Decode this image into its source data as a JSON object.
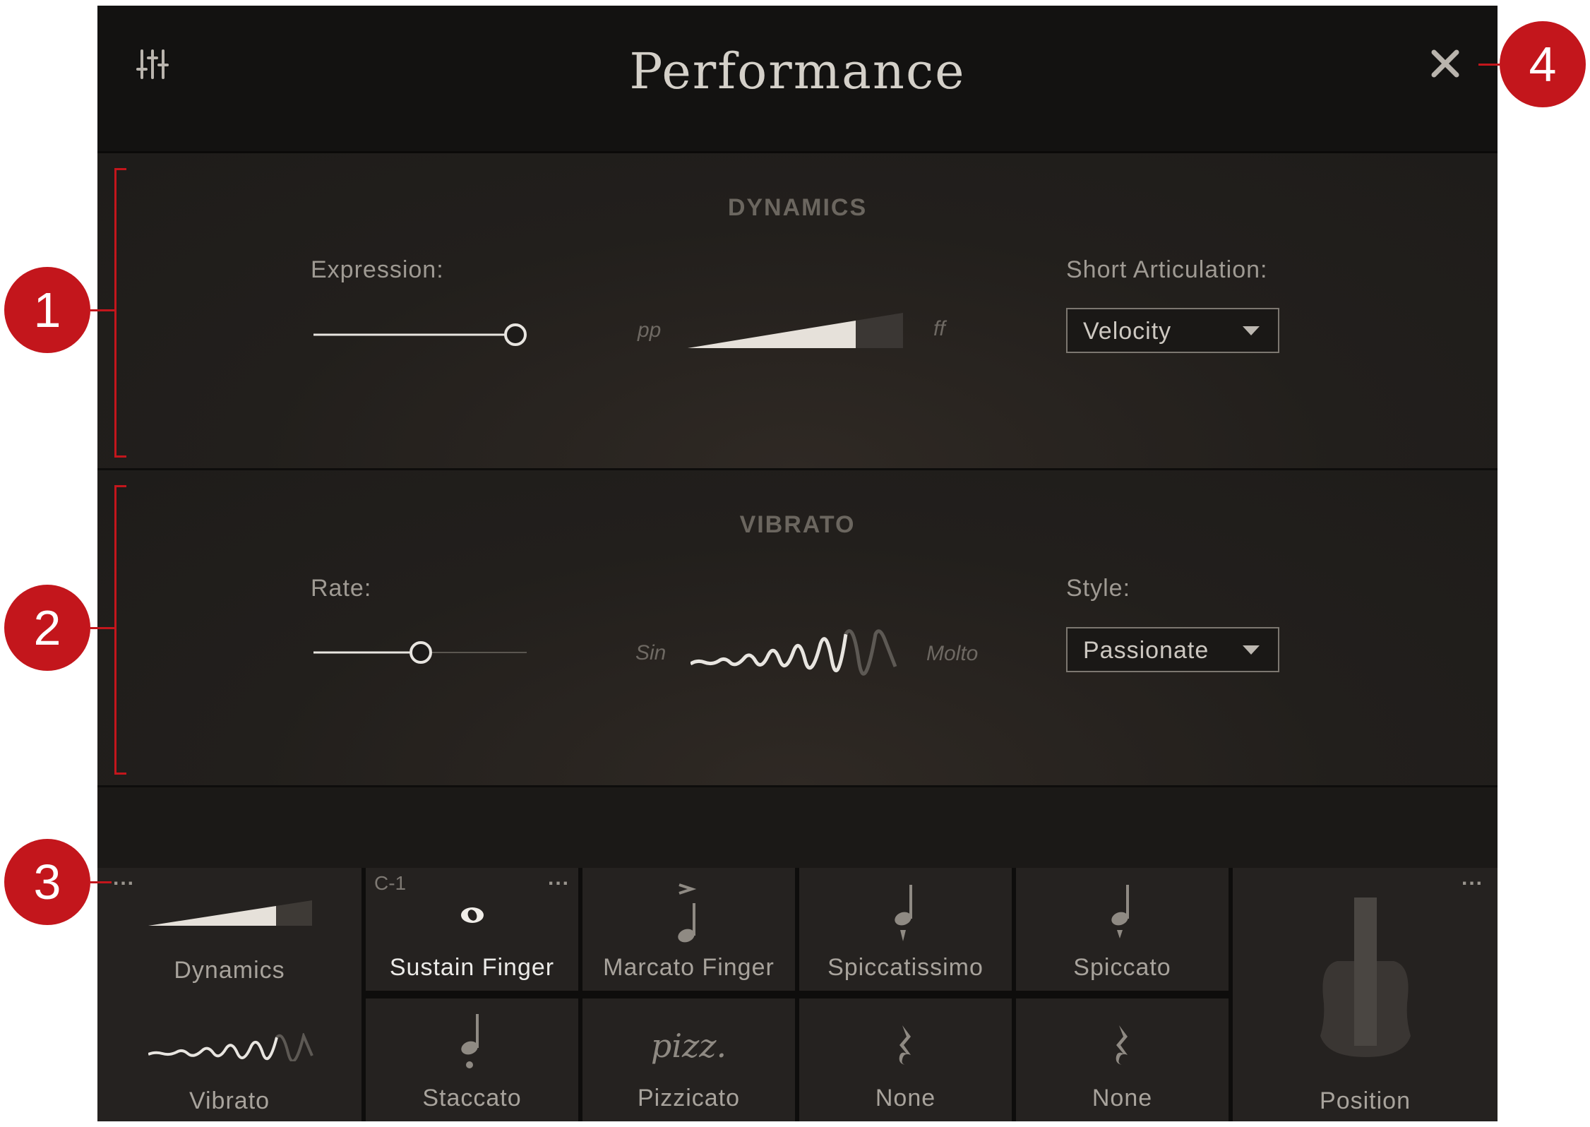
{
  "window": {
    "title": "Performance"
  },
  "header": {
    "mixer_icon": "mixer-sliders-icon",
    "close_icon": "close-icon"
  },
  "dynamics": {
    "title": "DYNAMICS",
    "expression": {
      "label": "Expression:",
      "value": 1.0
    },
    "range_low": "pp",
    "range_high": "ff",
    "short_articulation": {
      "label": "Short Articulation:",
      "value": "Velocity"
    }
  },
  "vibrato": {
    "title": "VIBRATO",
    "rate": {
      "label": "Rate:",
      "value": 0.5
    },
    "range_low": "Sin",
    "range_high": "Molto",
    "style": {
      "label": "Style:",
      "value": "Passionate"
    }
  },
  "strip": {
    "controls": [
      {
        "label": "Dynamics",
        "icon": "dynamics-ramp-icon"
      },
      {
        "label": "Vibrato",
        "icon": "vibrato-wave-icon"
      }
    ],
    "articulations_row1": [
      {
        "key": "C-1",
        "label": "Sustain Finger",
        "icon": "whole-note-icon",
        "active": true
      },
      {
        "label": "Marcato Finger",
        "icon": "marcato-note-icon"
      },
      {
        "label": "Spiccatissimo",
        "icon": "spiccatissimo-note-icon"
      },
      {
        "label": "Spiccato",
        "icon": "spiccato-note-icon"
      }
    ],
    "articulations_row2": [
      {
        "label": "Staccato",
        "icon": "staccato-note-icon"
      },
      {
        "label": "Pizzicato",
        "icon": "pizz-text-icon",
        "glyph": "pizz."
      },
      {
        "label": "None",
        "icon": "rest-icon"
      },
      {
        "label": "None",
        "icon": "rest-icon"
      }
    ],
    "position": {
      "label": "Position",
      "icon": "violin-position-icon"
    },
    "more_label": "..."
  },
  "callouts": [
    "1",
    "2",
    "3",
    "4"
  ],
  "colors": {
    "callout": "#c3161c",
    "panel": "#1d1b19",
    "header": "#131211"
  }
}
